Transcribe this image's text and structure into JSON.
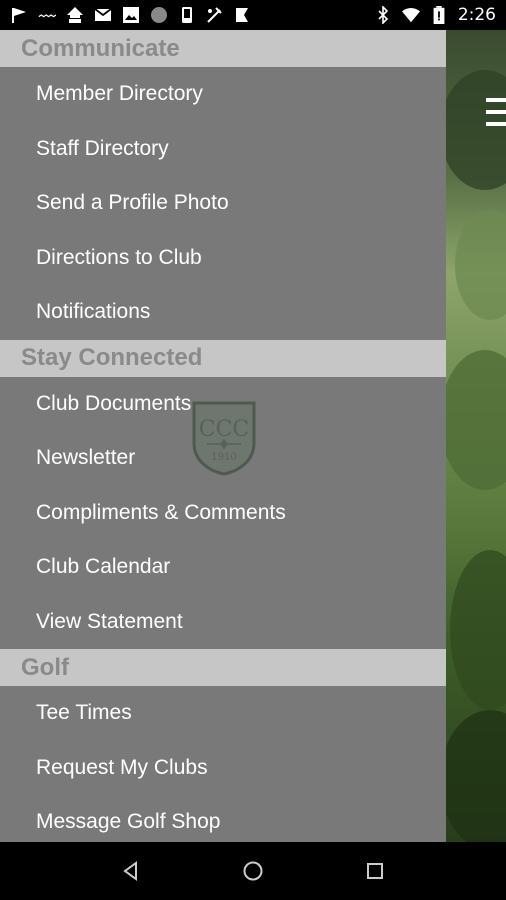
{
  "status_bar": {
    "time": "2:26",
    "left_icons": [
      "flag-icon",
      "voicemail-icon",
      "mm-icon",
      "gmail-icon",
      "image-icon",
      "circle-icon",
      "phone-icon",
      "golf-icon",
      "check-icon"
    ],
    "right_icons": [
      "bluetooth-icon",
      "wifi-icon",
      "battery-icon"
    ]
  },
  "drawer": {
    "sections": [
      {
        "header": "Communicate",
        "items": [
          "Member Directory",
          "Staff Directory",
          "Send a Profile Photo",
          "Directions to Club",
          "Notifications"
        ]
      },
      {
        "header": "Stay Connected",
        "items": [
          "Club Documents",
          "Newsletter",
          "Compliments & Comments",
          "Club Calendar",
          "View Statement"
        ]
      },
      {
        "header": "Golf",
        "items": [
          "Tee Times",
          "Request My Clubs",
          "Message Golf Shop"
        ]
      }
    ]
  },
  "emblem": {
    "monogram": "CCC",
    "year": "1910"
  },
  "nav_bar": {
    "buttons": [
      "back-icon",
      "home-icon",
      "recents-icon"
    ]
  },
  "colors": {
    "drawer_bg": "#797979",
    "section_header_bg": "#c6c6c6",
    "section_header_text": "#8a8a8a",
    "item_text": "#ffffff"
  }
}
